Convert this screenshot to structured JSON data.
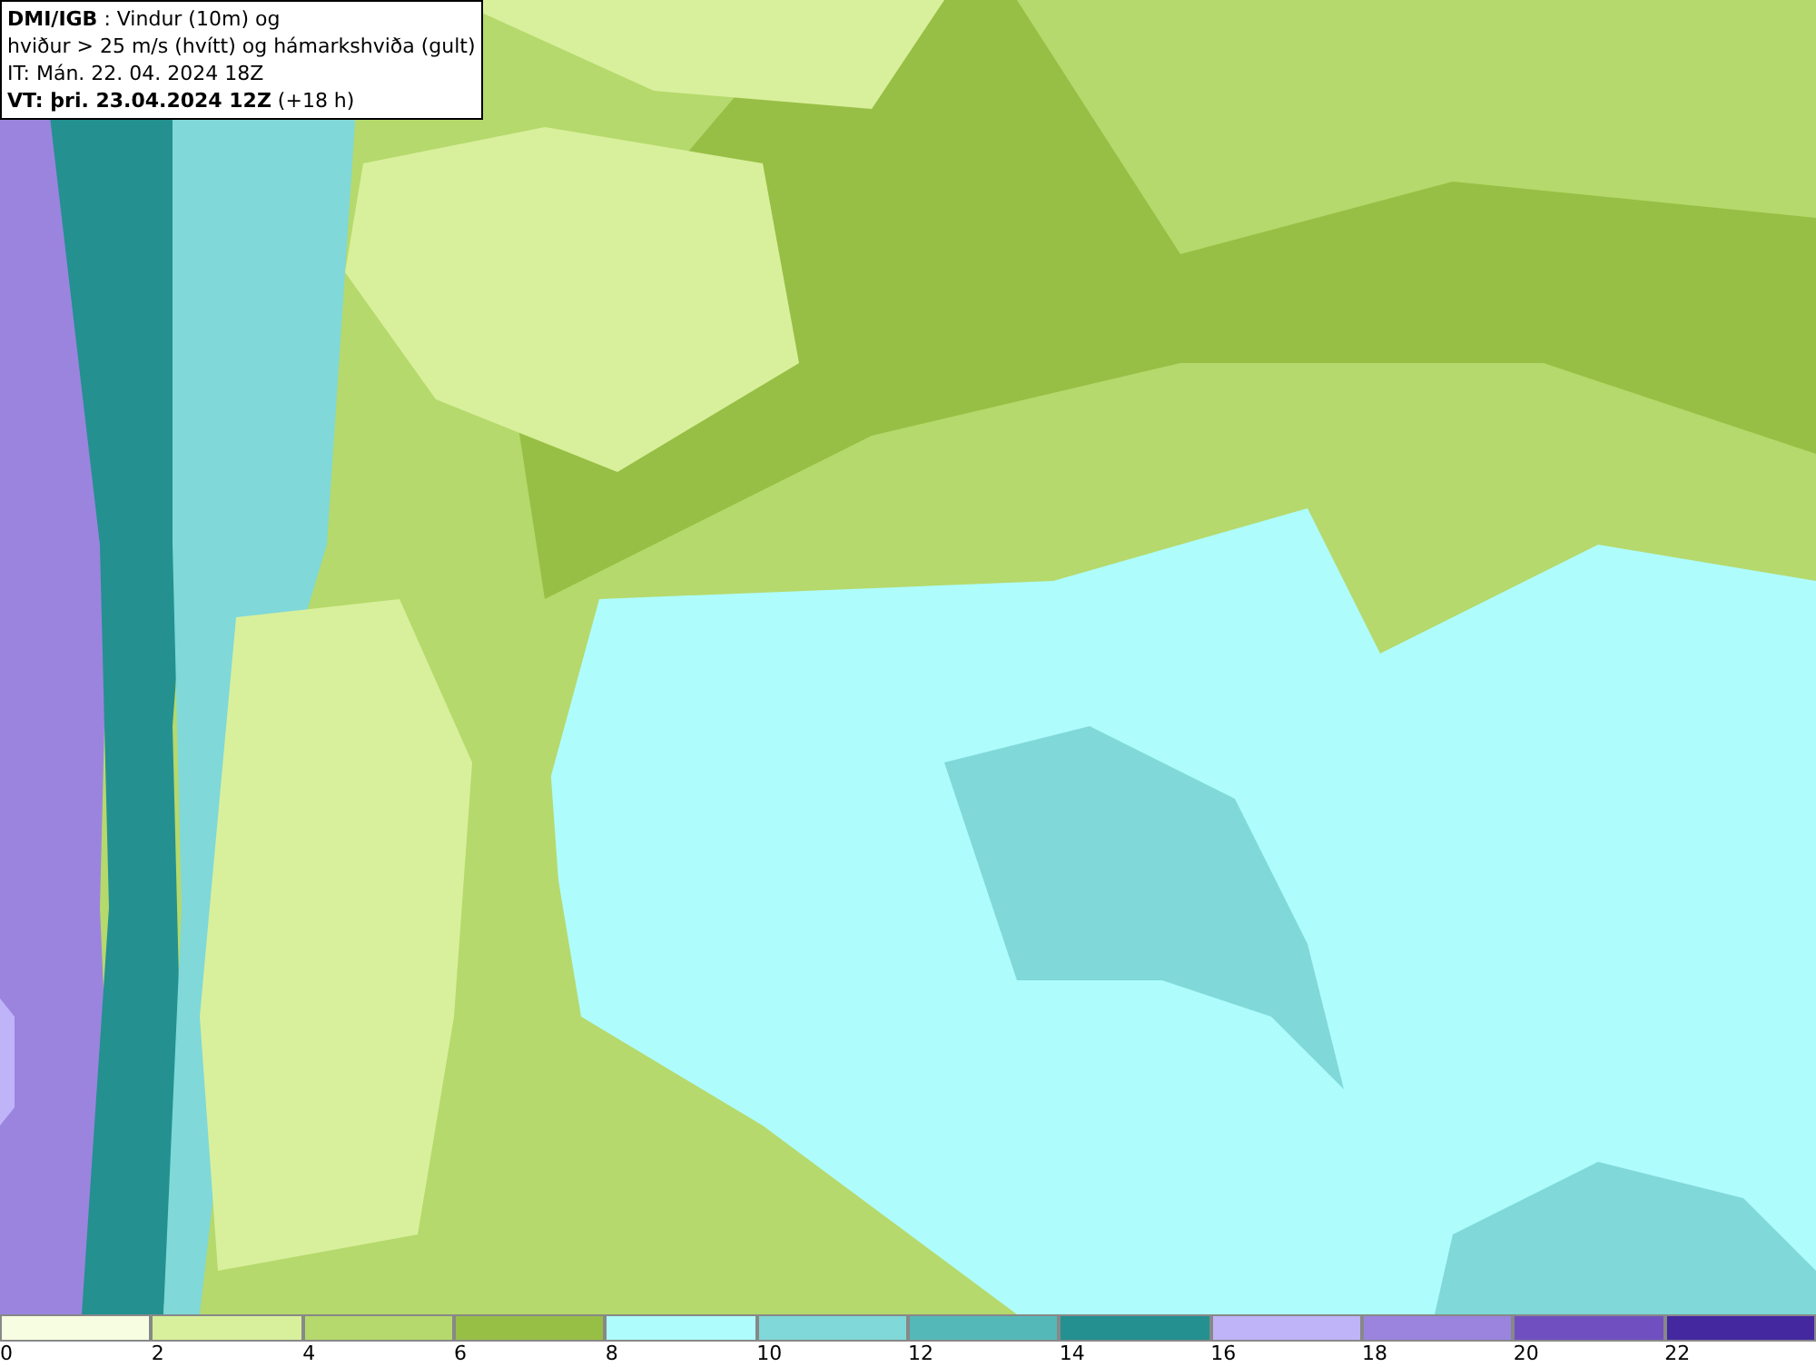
{
  "title_box": {
    "lines": [
      "**DMI/IGB** : Vindur (10m) og",
      "hviður > 25 m/s (hvítt) og hámarkshviða (gult)",
      "IT: Mán. 22. 04. 2024 18Z",
      "**VT: þri. 23.04.2024 12Z** (+18 h)"
    ]
  },
  "legend": [
    {
      "label": "0",
      "color": "#f7fde0"
    },
    {
      "label": "2",
      "color": "#d8f09c"
    },
    {
      "label": "4",
      "color": "#b5d96c"
    },
    {
      "label": "6",
      "color": "#98bf45"
    },
    {
      "label": "8",
      "color": "#aefcfc"
    },
    {
      "label": "10",
      "color": "#80d8d8"
    },
    {
      "label": "12",
      "color": "#55b8b8"
    },
    {
      "label": "14",
      "color": "#249090"
    },
    {
      "label": "16",
      "color": "#c0b4f8"
    },
    {
      "label": "18",
      "color": "#9a84de"
    },
    {
      "label": "20",
      "color": "#7050c0"
    },
    {
      "label": "22",
      "color": "#4428a0"
    }
  ]
}
